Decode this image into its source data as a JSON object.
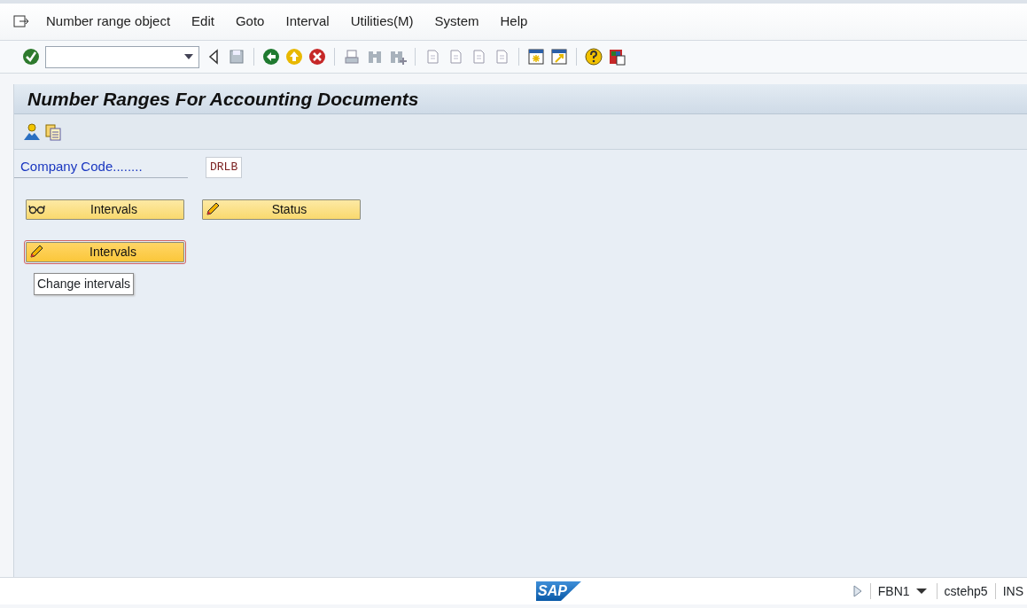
{
  "menu_bar": [
    {
      "label": "Number range object"
    },
    {
      "label": "Edit"
    },
    {
      "label": "Goto"
    },
    {
      "label": "Interval"
    },
    {
      "label": "Utilities(M)"
    },
    {
      "label": "System"
    },
    {
      "label": "Help"
    }
  ],
  "title": "Number Ranges For Accounting Documents",
  "company_code": {
    "label": "Company Code........",
    "value": "DRLB"
  },
  "buttons": [
    {
      "label": "Intervals",
      "kind": "display",
      "hovered": false
    },
    {
      "label": "Status",
      "kind": "change",
      "hovered": false
    },
    {
      "label": "Intervals",
      "kind": "change",
      "hovered": true
    }
  ],
  "tooltip": "Change intervals",
  "status_bar": {
    "logo": "SAP",
    "transaction": "FBN1",
    "server": "cstehp5",
    "mode": "INS"
  }
}
